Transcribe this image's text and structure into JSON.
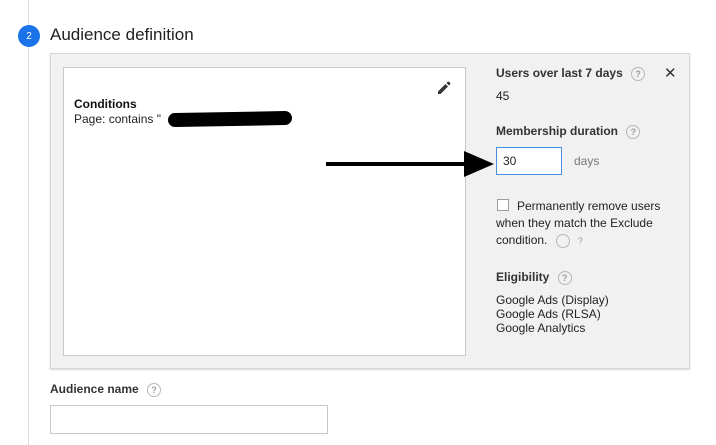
{
  "step": {
    "number": "2",
    "title": "Audience definition"
  },
  "conditions": {
    "title": "Conditions",
    "text": "Page: contains \""
  },
  "users": {
    "label": "Users over last 7 days",
    "value": "45"
  },
  "membership": {
    "label": "Membership duration",
    "value": "30",
    "unit": "days"
  },
  "permanent_remove": {
    "text": "Permanently remove users when they match the Exclude condition.",
    "checked": false
  },
  "eligibility": {
    "label": "Eligibility",
    "items": [
      "Google Ads (Display)",
      "Google Ads (RLSA)",
      "Google Analytics"
    ]
  },
  "audience_name": {
    "label": "Audience name",
    "value": ""
  },
  "help_glyph": "?",
  "close_glyph": "✕",
  "colors": {
    "accent": "#1a73e8",
    "panel_bg": "#f1f1f1",
    "input_focus": "#4a90e2"
  },
  "icons": {
    "edit": "pencil-icon",
    "close": "close-icon",
    "help": "help-icon"
  }
}
